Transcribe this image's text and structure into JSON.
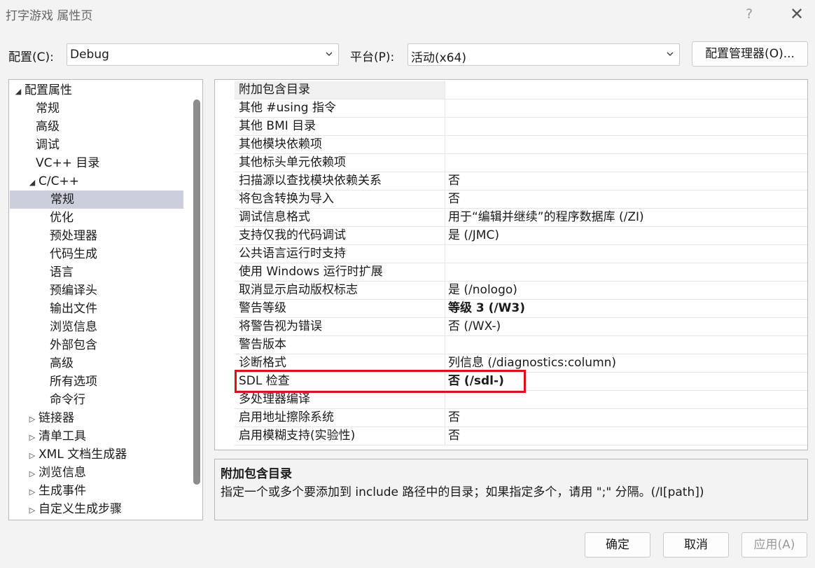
{
  "window": {
    "title": "打字游戏 属性页",
    "help": "?",
    "close": "✕"
  },
  "config": {
    "label": "配置(C):",
    "value": "Debug"
  },
  "platform": {
    "label": "平台(P):",
    "value": "活动(x64)"
  },
  "config_manager_label": "配置管理器(O)...",
  "tree": [
    {
      "label": "配置属性",
      "expander": "◢",
      "selected": false
    },
    {
      "label": "常规",
      "expander": "",
      "selected": false
    },
    {
      "label": "高级",
      "expander": "",
      "selected": false
    },
    {
      "label": "调试",
      "expander": "",
      "selected": false
    },
    {
      "label": "VC++ 目录",
      "expander": "",
      "selected": false
    },
    {
      "label": "C/C++",
      "expander": "◢",
      "selected": false
    },
    {
      "label": "常规",
      "expander": "",
      "selected": true
    },
    {
      "label": "优化",
      "expander": "",
      "selected": false
    },
    {
      "label": "预处理器",
      "expander": "",
      "selected": false
    },
    {
      "label": "代码生成",
      "expander": "",
      "selected": false
    },
    {
      "label": "语言",
      "expander": "",
      "selected": false
    },
    {
      "label": "预编译头",
      "expander": "",
      "selected": false
    },
    {
      "label": "输出文件",
      "expander": "",
      "selected": false
    },
    {
      "label": "浏览信息",
      "expander": "",
      "selected": false
    },
    {
      "label": "外部包含",
      "expander": "",
      "selected": false
    },
    {
      "label": "高级",
      "expander": "",
      "selected": false
    },
    {
      "label": "所有选项",
      "expander": "",
      "selected": false
    },
    {
      "label": "命令行",
      "expander": "",
      "selected": false
    },
    {
      "label": "链接器",
      "expander": "▷",
      "selected": false
    },
    {
      "label": "清单工具",
      "expander": "▷",
      "selected": false
    },
    {
      "label": "XML 文档生成器",
      "expander": "▷",
      "selected": false
    },
    {
      "label": "浏览信息",
      "expander": "▷",
      "selected": false
    },
    {
      "label": "生成事件",
      "expander": "▷",
      "selected": false
    },
    {
      "label": "自定义生成步骤",
      "expander": "▷",
      "selected": false
    }
  ],
  "properties": [
    {
      "name": "附加包含目录",
      "value": "",
      "bold": false
    },
    {
      "name": "其他 #using 指令",
      "value": "",
      "bold": false
    },
    {
      "name": "其他 BMI 目录",
      "value": "",
      "bold": false
    },
    {
      "name": "其他模块依赖项",
      "value": "",
      "bold": false
    },
    {
      "name": "其他标头单元依赖项",
      "value": "",
      "bold": false
    },
    {
      "name": "扫描源以查找模块依赖关系",
      "value": "否",
      "bold": false
    },
    {
      "name": "将包含转换为导入",
      "value": "否",
      "bold": false
    },
    {
      "name": "调试信息格式",
      "value": "用于“编辑并继续”的程序数据库 (/ZI)",
      "bold": false
    },
    {
      "name": "支持仅我的代码调试",
      "value": "是 (/JMC)",
      "bold": false
    },
    {
      "name": "公共语言运行时支持",
      "value": "",
      "bold": false
    },
    {
      "name": "使用 Windows 运行时扩展",
      "value": "",
      "bold": false
    },
    {
      "name": "取消显示启动版权标志",
      "value": "是 (/nologo)",
      "bold": false
    },
    {
      "name": "警告等级",
      "value": "等级 3 (/W3)",
      "bold": true
    },
    {
      "name": "将警告视为错误",
      "value": "否 (/WX-)",
      "bold": false
    },
    {
      "name": "警告版本",
      "value": "",
      "bold": false
    },
    {
      "name": "诊断格式",
      "value": "列信息 (/diagnostics:column)",
      "bold": false
    },
    {
      "name": "SDL 检查",
      "value": "否 (/sdl-)",
      "bold": true
    },
    {
      "name": "多处理器编译",
      "value": "",
      "bold": false
    },
    {
      "name": "启用地址擦除系统",
      "value": "否",
      "bold": false
    },
    {
      "name": "启用模糊支持(实验性)",
      "value": "否",
      "bold": false
    }
  ],
  "description": {
    "title": "附加包含目录",
    "text": "指定一个或多个要添加到 include 路径中的目录；如果指定多个，请用 \";\" 分隔。(/I[path])"
  },
  "buttons": {
    "ok": "确定",
    "cancel": "取消",
    "apply": "应用(A)"
  },
  "colors": {
    "highlight_box": "#e0101b",
    "selected_tree": "#cccedb"
  }
}
